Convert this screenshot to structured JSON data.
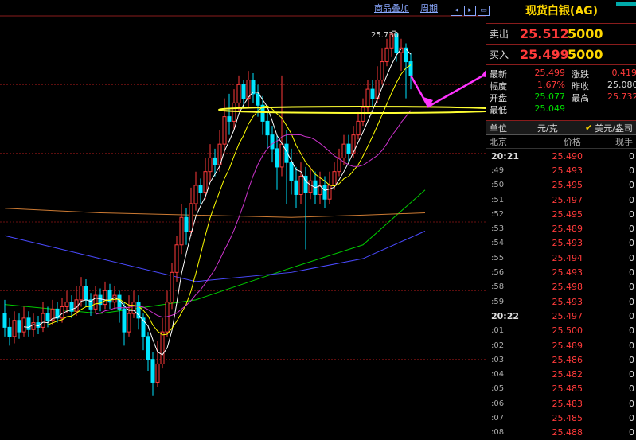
{
  "toolbar": {
    "overlay_label": "商品叠加",
    "period_label": "周期",
    "btn_icons": [
      "prev-icon",
      "next-icon",
      "maximize-icon"
    ]
  },
  "quote": {
    "title": "现货白银(AG)",
    "sell_label": "卖出",
    "sell_price": "25.512",
    "sell_vol": "5000",
    "buy_label": "买入",
    "buy_price": "25.499",
    "buy_vol": "5000",
    "stats": [
      {
        "l1": "最新",
        "v1": "25.499",
        "c1": "red",
        "l2": "涨跌",
        "v2": "0.419",
        "c2": "red"
      },
      {
        "l1": "幅度",
        "v1": "1.67%",
        "c1": "red",
        "l2": "昨收",
        "v2": "25.080",
        "c2": "wht"
      },
      {
        "l1": "开盘",
        "v1": "25.077",
        "c1": "grn",
        "l2": "最高",
        "v2": "25.732",
        "c2": "red"
      },
      {
        "l1": "最低",
        "v1": "25.049",
        "c1": "grn",
        "l2": "",
        "v2": "",
        "c2": "wht"
      }
    ],
    "unit_label": "单位",
    "unit_value": "元/克",
    "unit_option": "美元/盎司",
    "col_time": "北京",
    "col_price": "价格",
    "col_vol": "现手"
  },
  "ticks": [
    {
      "t": "20:21",
      "p": "25.490",
      "v": "0",
      "big": true
    },
    {
      "t": ":49",
      "p": "25.493",
      "v": "0"
    },
    {
      "t": ":50",
      "p": "25.495",
      "v": "0"
    },
    {
      "t": ":51",
      "p": "25.497",
      "v": "0"
    },
    {
      "t": ":52",
      "p": "25.495",
      "v": "0"
    },
    {
      "t": ":53",
      "p": "25.489",
      "v": "0"
    },
    {
      "t": ":54",
      "p": "25.493",
      "v": "0"
    },
    {
      "t": ":55",
      "p": "25.494",
      "v": "0"
    },
    {
      "t": ":56",
      "p": "25.493",
      "v": "0"
    },
    {
      "t": ":58",
      "p": "25.498",
      "v": "0"
    },
    {
      "t": ":59",
      "p": "25.493",
      "v": "0"
    },
    {
      "t": "20:22",
      "p": "25.497",
      "v": "0",
      "big": true
    },
    {
      "t": ":01",
      "p": "25.500",
      "v": "0"
    },
    {
      "t": ":02",
      "p": "25.489",
      "v": "0"
    },
    {
      "t": ":03",
      "p": "25.486",
      "v": "0"
    },
    {
      "t": ":04",
      "p": "25.482",
      "v": "0"
    },
    {
      "t": ":05",
      "p": "25.485",
      "v": "0"
    },
    {
      "t": ":06",
      "p": "25.483",
      "v": "0"
    },
    {
      "t": ":07",
      "p": "25.485",
      "v": "0"
    },
    {
      "t": ":08",
      "p": "25.488",
      "v": "0"
    }
  ],
  "chart_data": {
    "type": "candlestick",
    "high_label": "25.730",
    "ylim": [
      24.0,
      25.8
    ],
    "grid": true,
    "up_color": "#ff3a3a",
    "down_color": "#00e5ff",
    "candles": [
      [
        24.5,
        24.44,
        24.56,
        24.4
      ],
      [
        24.44,
        24.4,
        24.48,
        24.36
      ],
      [
        24.4,
        24.47,
        24.51,
        24.37
      ],
      [
        24.47,
        24.42,
        24.5,
        24.39
      ],
      [
        24.42,
        24.48,
        24.53,
        24.4
      ],
      [
        24.48,
        24.43,
        24.51,
        24.4
      ],
      [
        24.43,
        24.46,
        24.5,
        24.4
      ],
      [
        24.46,
        24.44,
        24.49,
        24.41
      ],
      [
        24.44,
        24.5,
        24.55,
        24.42
      ],
      [
        24.5,
        24.47,
        24.53,
        24.44
      ],
      [
        24.47,
        24.52,
        24.56,
        24.45
      ],
      [
        24.52,
        24.48,
        24.55,
        24.46
      ],
      [
        24.48,
        24.53,
        24.57,
        24.46
      ],
      [
        24.53,
        24.55,
        24.6,
        24.5
      ],
      [
        24.55,
        24.51,
        24.58,
        24.48
      ],
      [
        24.51,
        24.56,
        24.62,
        24.49
      ],
      [
        24.56,
        24.62,
        24.66,
        24.53
      ],
      [
        24.62,
        24.56,
        24.65,
        24.53
      ],
      [
        24.56,
        24.52,
        24.59,
        24.49
      ],
      [
        24.52,
        24.58,
        24.62,
        24.5
      ],
      [
        24.58,
        24.54,
        24.61,
        24.51
      ],
      [
        24.54,
        24.6,
        24.64,
        24.52
      ],
      [
        24.6,
        24.55,
        24.63,
        24.52
      ],
      [
        24.55,
        24.58,
        24.62,
        24.52
      ],
      [
        24.58,
        24.52,
        24.6,
        24.46
      ],
      [
        24.52,
        24.42,
        24.55,
        24.36
      ],
      [
        24.42,
        24.5,
        24.58,
        24.4
      ],
      [
        24.5,
        24.55,
        24.6,
        24.48
      ],
      [
        24.55,
        24.48,
        24.58,
        24.43
      ],
      [
        24.48,
        24.4,
        24.5,
        24.34
      ],
      [
        24.4,
        24.3,
        24.42,
        24.25
      ],
      [
        24.3,
        24.2,
        24.33,
        24.14
      ],
      [
        24.2,
        24.28,
        24.38,
        24.18
      ],
      [
        24.28,
        24.42,
        24.48,
        24.26
      ],
      [
        24.42,
        24.55,
        24.6,
        24.4
      ],
      [
        24.55,
        24.68,
        24.72,
        24.52
      ],
      [
        24.68,
        24.8,
        24.84,
        24.64
      ],
      [
        24.8,
        24.92,
        24.98,
        24.76
      ],
      [
        24.92,
        24.86,
        24.96,
        24.8
      ],
      [
        24.86,
        24.98,
        25.05,
        24.84
      ],
      [
        24.98,
        25.06,
        25.12,
        24.95
      ],
      [
        25.06,
        25.03,
        25.09,
        24.98
      ],
      [
        25.03,
        25.12,
        25.18,
        25.0
      ],
      [
        25.12,
        25.18,
        25.24,
        25.08
      ],
      [
        25.18,
        25.15,
        25.22,
        25.1
      ],
      [
        25.15,
        25.24,
        25.3,
        25.12
      ],
      [
        25.24,
        25.36,
        25.44,
        25.2
      ],
      [
        25.36,
        25.34,
        25.46,
        25.28
      ],
      [
        25.34,
        25.42,
        25.48,
        25.3
      ],
      [
        25.42,
        25.5,
        25.54,
        25.38
      ],
      [
        25.5,
        25.44,
        25.52,
        25.4
      ],
      [
        25.44,
        25.52,
        25.56,
        25.4
      ],
      [
        25.52,
        25.46,
        25.55,
        25.42
      ],
      [
        25.46,
        25.41,
        25.5,
        25.36
      ],
      [
        25.41,
        25.34,
        25.45,
        25.28
      ],
      [
        25.34,
        25.28,
        25.38,
        25.22
      ],
      [
        25.28,
        25.22,
        25.32,
        25.16
      ],
      [
        25.22,
        25.14,
        25.28,
        25.04
      ],
      [
        25.14,
        25.24,
        25.54,
        25.1
      ],
      [
        25.24,
        25.16,
        25.3,
        24.98
      ],
      [
        25.16,
        25.08,
        25.22,
        25.02
      ],
      [
        25.08,
        25.02,
        25.14,
        24.96
      ],
      [
        25.02,
        25.1,
        25.16,
        24.98
      ],
      [
        25.1,
        25.03,
        25.14,
        24.78
      ],
      [
        25.03,
        25.08,
        25.14,
        25.0
      ],
      [
        25.08,
        25.02,
        25.12,
        24.98
      ],
      [
        25.02,
        25.06,
        25.12,
        24.98
      ],
      [
        25.06,
        25.0,
        25.1,
        24.96
      ],
      [
        25.0,
        25.06,
        25.12,
        24.98
      ],
      [
        25.06,
        25.12,
        25.16,
        25.04
      ],
      [
        25.12,
        25.18,
        25.22,
        25.1
      ],
      [
        25.18,
        25.24,
        25.28,
        25.15
      ],
      [
        25.24,
        25.2,
        25.28,
        25.16
      ],
      [
        25.2,
        25.28,
        25.32,
        25.18
      ],
      [
        25.28,
        25.34,
        25.38,
        25.26
      ],
      [
        25.34,
        25.4,
        25.44,
        25.32
      ],
      [
        25.4,
        25.48,
        25.52,
        25.38
      ],
      [
        25.48,
        25.44,
        25.52,
        25.4
      ],
      [
        25.44,
        25.52,
        25.58,
        25.42
      ],
      [
        25.52,
        25.6,
        25.66,
        25.5
      ],
      [
        25.6,
        25.66,
        25.7,
        25.58
      ],
      [
        25.66,
        25.72,
        25.73,
        25.62
      ],
      [
        25.72,
        25.64,
        25.73,
        25.6
      ],
      [
        25.64,
        25.66,
        25.7,
        25.56
      ],
      [
        25.66,
        25.6,
        25.68,
        25.44
      ],
      [
        25.6,
        25.54,
        25.64,
        25.48
      ]
    ],
    "ma": [
      {
        "name": "ma5",
        "color": "#ffffff",
        "period": 5
      },
      {
        "name": "ma10",
        "color": "#ffff00",
        "period": 10
      },
      {
        "name": "ma20",
        "color": "#cc33cc",
        "period": 20
      }
    ],
    "long_lines": [
      {
        "name": "ma-long-1",
        "color": "#00cc00",
        "points": [
          [
            0,
            24.54
          ],
          [
            20,
            24.5
          ],
          [
            40,
            24.56
          ],
          [
            60,
            24.7
          ],
          [
            75,
            24.8
          ],
          [
            88,
            25.04
          ]
        ]
      },
      {
        "name": "ma-long-2",
        "color": "#4a4aff",
        "points": [
          [
            0,
            24.84
          ],
          [
            20,
            24.74
          ],
          [
            40,
            24.64
          ],
          [
            60,
            24.68
          ],
          [
            75,
            24.74
          ],
          [
            88,
            24.86
          ]
        ]
      },
      {
        "name": "ma-long-3",
        "color": "#cc7a33",
        "points": [
          [
            0,
            24.96
          ],
          [
            20,
            24.94
          ],
          [
            40,
            24.93
          ],
          [
            60,
            24.92
          ],
          [
            75,
            24.93
          ],
          [
            88,
            24.94
          ]
        ]
      }
    ],
    "annotation_level": 25.39
  }
}
